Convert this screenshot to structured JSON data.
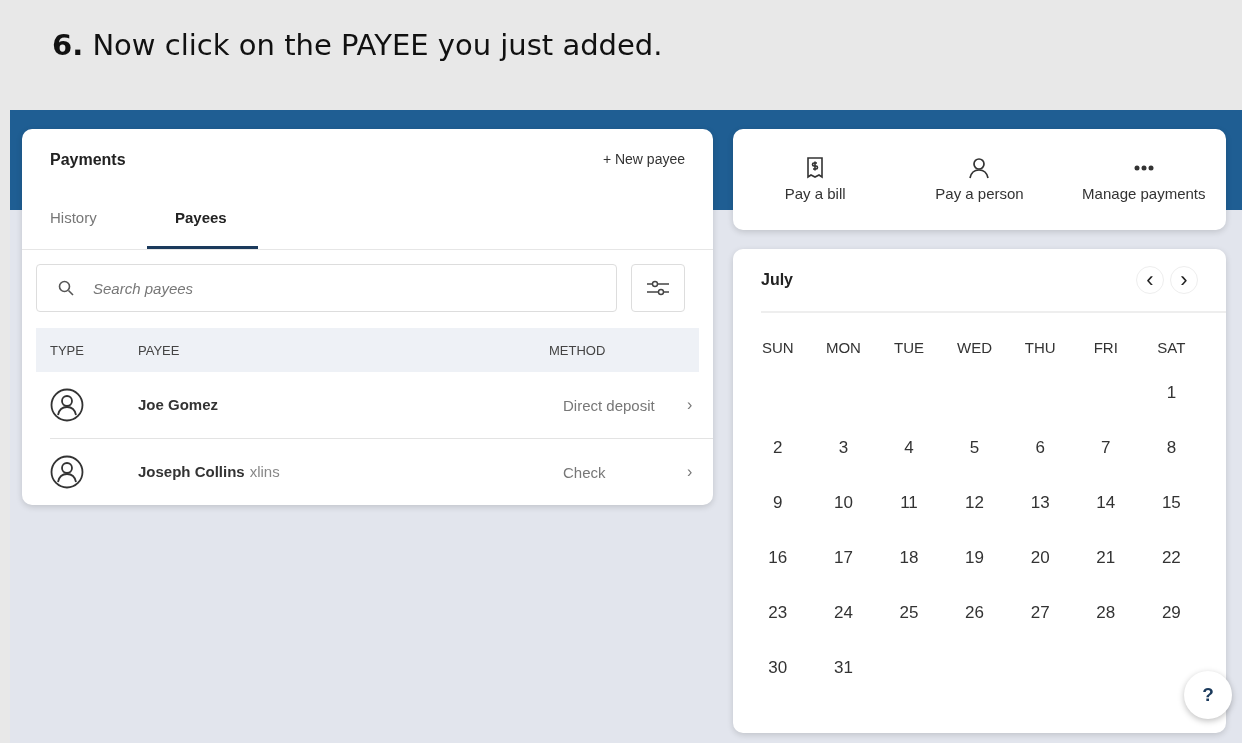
{
  "slide_title": "**6.** Now click on the PAYEE you just added.",
  "payments": {
    "title": "Payments",
    "new_payee": "+ New payee",
    "tabs": [
      {
        "label": "History",
        "selected": false
      },
      {
        "label": "Payees",
        "selected": true
      }
    ],
    "search": {
      "placeholder": "Search payees"
    },
    "columns": [
      "TYPE",
      "PAYEE",
      "METHOD"
    ],
    "rows": [
      {
        "name": "Joe Gomez",
        "method": "Direct deposit",
        "chevron": "›"
      },
      {
        "name": "Joseph Collins",
        "note": "xlins",
        "method": "Check",
        "chevron": "›"
      }
    ]
  },
  "actions": [
    {
      "kind": "bill",
      "label": "Pay a bill"
    },
    {
      "kind": "person",
      "label": "Pay a person"
    },
    {
      "kind": "more",
      "label": "Manage payments"
    }
  ],
  "calendar": {
    "month": "July",
    "prev": "‹",
    "next": "›",
    "weekdays": [
      "SUN",
      "MON",
      "TUE",
      "WED",
      "THU",
      "FRI",
      "SAT"
    ],
    "weeks": [
      [
        "1"
      ],
      [
        "2",
        "3",
        "4",
        "5",
        "6",
        "7",
        "8"
      ],
      [
        "9",
        "10",
        "11",
        "12",
        "13",
        "14",
        "15"
      ],
      [
        "16",
        "17",
        "18",
        "19",
        "20",
        "21",
        "22"
      ],
      [
        "23",
        "24",
        "25",
        "26",
        "27",
        "28",
        "29"
      ],
      [
        "30",
        "31"
      ]
    ]
  },
  "help": "?"
}
